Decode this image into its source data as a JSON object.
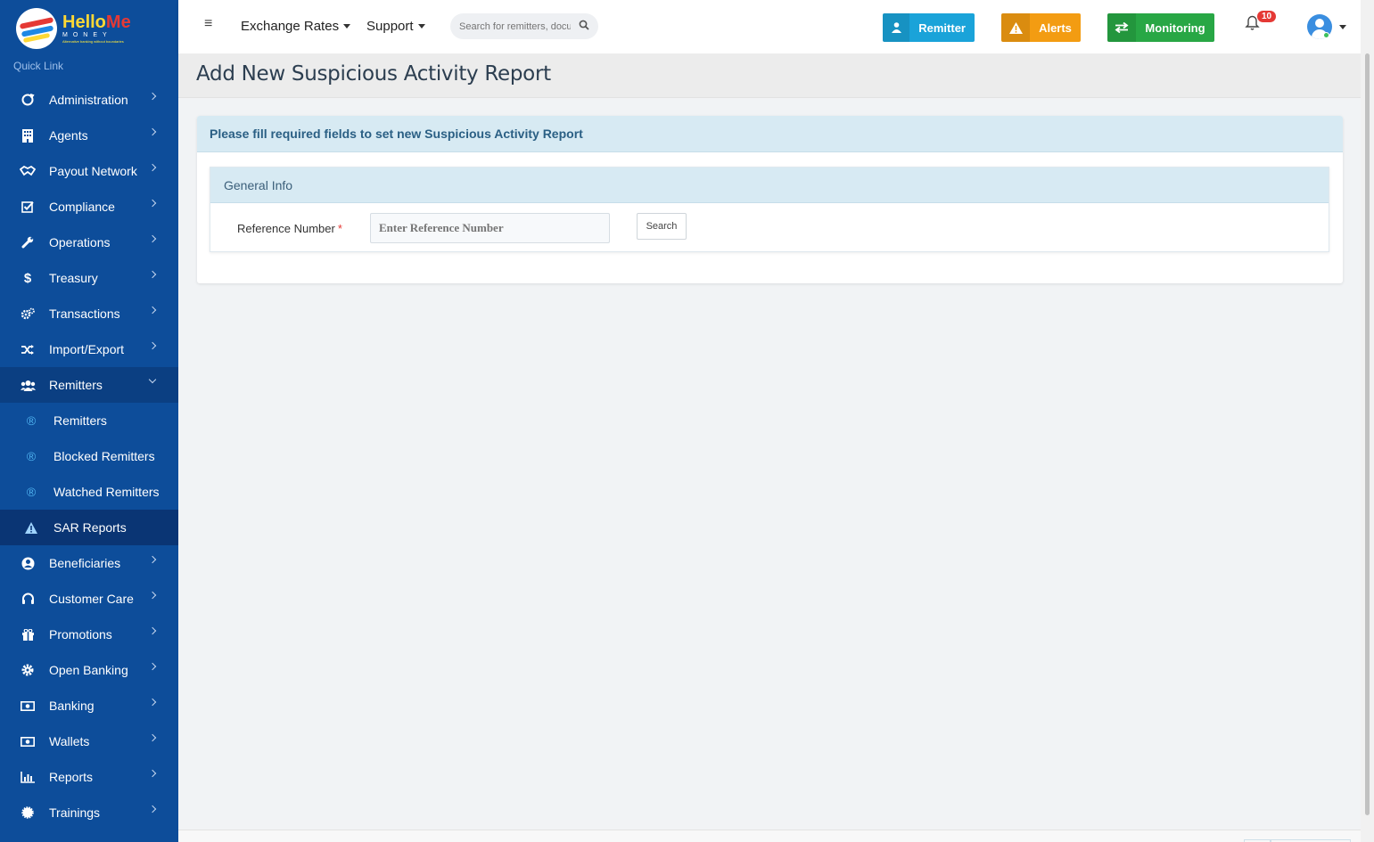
{
  "brand": {
    "name_part1": "Hello",
    "name_part2": "Me",
    "sub": "MONEY",
    "tagline": "Alternative banking without boundaries"
  },
  "sidebar": {
    "quick_link": "Quick Link",
    "items": [
      {
        "label": "Administration",
        "icon": "circle-arrow-icon"
      },
      {
        "label": "Agents",
        "icon": "building-icon"
      },
      {
        "label": "Payout Network",
        "icon": "handshake-icon"
      },
      {
        "label": "Compliance",
        "icon": "check-square-icon"
      },
      {
        "label": "Operations",
        "icon": "wrench-icon"
      },
      {
        "label": "Treasury",
        "icon": "dollar-icon"
      },
      {
        "label": "Transactions",
        "icon": "cogs-icon"
      },
      {
        "label": "Import/Export",
        "icon": "shuffle-icon"
      },
      {
        "label": "Remitters",
        "icon": "users-icon"
      }
    ],
    "sub_items": [
      {
        "label": "Remitters",
        "icon": "registered-icon"
      },
      {
        "label": "Blocked Remitters",
        "icon": "registered-icon"
      },
      {
        "label": "Watched Remitters",
        "icon": "registered-icon"
      },
      {
        "label": "SAR Reports",
        "icon": "warning-icon"
      }
    ],
    "items_after": [
      {
        "label": "Beneficiaries",
        "icon": "user-circle-icon"
      },
      {
        "label": "Customer Care",
        "icon": "headset-icon"
      },
      {
        "label": "Promotions",
        "icon": "gift-icon"
      },
      {
        "label": "Open Banking",
        "icon": "gear-icon"
      },
      {
        "label": "Banking",
        "icon": "money-icon"
      },
      {
        "label": "Wallets",
        "icon": "money-icon"
      },
      {
        "label": "Reports",
        "icon": "bar-chart-icon"
      },
      {
        "label": "Trainings",
        "icon": "badge-icon"
      }
    ]
  },
  "topbar": {
    "exchange_rates": "Exchange Rates",
    "support": "Support",
    "search_placeholder": "Search for remitters, documents",
    "remitter_btn": "Remitter",
    "alerts_btn": "Alerts",
    "monitoring_btn": "Monitoring",
    "notification_count": "10"
  },
  "colors": {
    "sidebar": "#0d4d9a",
    "remitter": "#1aa3d9",
    "alerts": "#f39c12",
    "monitoring": "#28a745"
  },
  "page": {
    "title": "Add New Suspicious Activity Report",
    "card_header": "Please fill required fields to set new Suspicious Activity Report",
    "section_title": "General Info",
    "reference_label": "Reference Number",
    "required_mark": "*",
    "reference_placeholder": "Enter Reference Number",
    "search_button": "Search"
  }
}
